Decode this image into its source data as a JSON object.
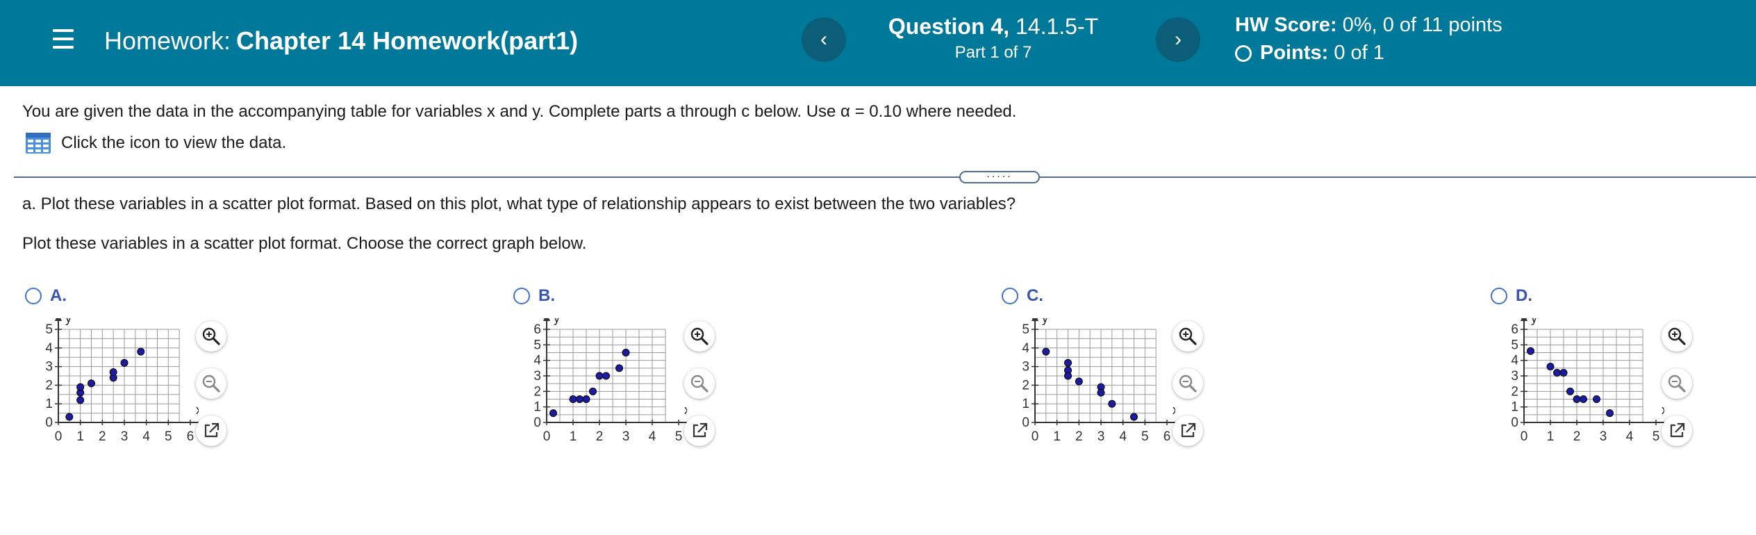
{
  "header": {
    "hw_label": "Homework:",
    "hw_name": "Chapter 14 Homework(part1)",
    "question_label": "Question 4,",
    "question_id": "14.1.5-T",
    "part": "Part 1 of 7",
    "score_label": "HW Score:",
    "score_value": "0%, 0 of 11 points",
    "points_label": "Points:",
    "points_value": "0 of 1",
    "prev_glyph": "‹",
    "next_glyph": "›"
  },
  "body": {
    "intro": "You are given the data in the accompanying table for variables x and y. Complete parts a through c below. Use α = 0.10 where needed.",
    "data_link": "Click the icon to view the data.",
    "handle_dots": ".....",
    "question_a": "a. Plot these variables in a scatter plot format. Based on this plot, what type of relationship appears to exist between the two variables?",
    "instruction": "Plot these variables in a scatter plot format. Choose the correct graph below."
  },
  "colors": {
    "header_bg": "#00789a",
    "nav_btn": "#0b5d78",
    "radio": "#3f74c8",
    "option_letter": "#3855b3",
    "point_fill": "#1b1ba3"
  },
  "icons": {
    "menu": "hamburger-menu-icon",
    "table": "table-grid-icon",
    "zoom_in": "zoom-in-icon",
    "zoom_out": "zoom-out-icon",
    "popout": "popout-icon"
  },
  "options": [
    {
      "letter": "A.",
      "chart_data": {
        "type": "scatter",
        "xlabel": "x",
        "ylabel": "y",
        "xlim": [
          0,
          6
        ],
        "ylim": [
          0,
          5
        ],
        "x_ticks": [
          "0",
          "1",
          "2",
          "3",
          "4",
          "5",
          "6"
        ],
        "y_ticks": [
          "0",
          "1",
          "2",
          "3",
          "4",
          "5"
        ],
        "points": [
          [
            0.5,
            0.3
          ],
          [
            1,
            1.2
          ],
          [
            1,
            1.6
          ],
          [
            1,
            1.9
          ],
          [
            1.5,
            2.1
          ],
          [
            2.5,
            2.4
          ],
          [
            2.5,
            2.7
          ],
          [
            3,
            3.2
          ],
          [
            3.75,
            3.8
          ]
        ]
      }
    },
    {
      "letter": "B.",
      "chart_data": {
        "type": "scatter",
        "xlabel": "x",
        "ylabel": "y",
        "xlim": [
          0,
          5
        ],
        "ylim": [
          0,
          6
        ],
        "x_ticks": [
          "0",
          "1",
          "2",
          "3",
          "4",
          "5"
        ],
        "y_ticks": [
          "0",
          "1",
          "2",
          "3",
          "4",
          "5",
          "6"
        ],
        "points": [
          [
            0.25,
            0.6
          ],
          [
            1,
            1.5
          ],
          [
            1.25,
            1.5
          ],
          [
            1.5,
            1.5
          ],
          [
            1.75,
            2
          ],
          [
            2,
            3
          ],
          [
            2.25,
            3
          ],
          [
            2.75,
            3.5
          ],
          [
            3,
            4.5
          ]
        ]
      }
    },
    {
      "letter": "C.",
      "chart_data": {
        "type": "scatter",
        "xlabel": "x",
        "ylabel": "y",
        "xlim": [
          0,
          6
        ],
        "ylim": [
          0,
          5
        ],
        "x_ticks": [
          "0",
          "1",
          "2",
          "3",
          "4",
          "5",
          "6"
        ],
        "y_ticks": [
          "0",
          "1",
          "2",
          "3",
          "4",
          "5"
        ],
        "points": [
          [
            0.5,
            3.8
          ],
          [
            1.5,
            3.2
          ],
          [
            1.5,
            2.8
          ],
          [
            1.5,
            2.5
          ],
          [
            2,
            2.2
          ],
          [
            3,
            1.9
          ],
          [
            3,
            1.6
          ],
          [
            3.5,
            1
          ],
          [
            4.5,
            0.3
          ]
        ]
      }
    },
    {
      "letter": "D.",
      "chart_data": {
        "type": "scatter",
        "xlabel": "x",
        "ylabel": "y",
        "xlim": [
          0,
          5
        ],
        "ylim": [
          0,
          6
        ],
        "x_ticks": [
          "0",
          "1",
          "2",
          "3",
          "4",
          "5"
        ],
        "y_ticks": [
          "0",
          "1",
          "2",
          "3",
          "4",
          "5",
          "6"
        ],
        "points": [
          [
            0.25,
            4.6
          ],
          [
            1,
            3.6
          ],
          [
            1.25,
            3.2
          ],
          [
            1.5,
            3.2
          ],
          [
            1.75,
            2
          ],
          [
            2,
            1.5
          ],
          [
            2.25,
            1.5
          ],
          [
            2.75,
            1.5
          ],
          [
            3.25,
            0.6
          ]
        ]
      }
    }
  ]
}
